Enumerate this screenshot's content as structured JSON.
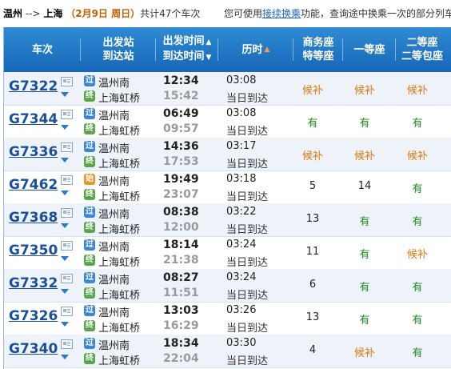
{
  "header": {
    "from": "温州",
    "arrow": "-->",
    "to": "上海",
    "date": "（2月9日 周日）",
    "total_prefix": "共计",
    "total_count": "47",
    "total_suffix": "个车次",
    "tip_prefix": "您可使用",
    "tip_link": "接续换乘",
    "tip_suffix": "功能，查询途中换乘一次的部分列车"
  },
  "columns": {
    "train": "车次",
    "station_dep": "出发站",
    "station_arr": "到达站",
    "time_dep": "出发时间",
    "time_arr": "到达时间",
    "duration": "历时",
    "business_1": "商务座",
    "business_2": "特等座",
    "first": "一等座",
    "second_1": "二等座",
    "second_2": "二等包座"
  },
  "trains": [
    {
      "no": "G7322",
      "dep_station": "温州南",
      "dep_type": "过",
      "arr_station": "上海虹桥",
      "arr_type": "终",
      "dep": "12:34",
      "arr": "15:42",
      "duration": "03:08",
      "arrive_day": "当日到达",
      "business": "候补",
      "first": "候补",
      "second": "候补"
    },
    {
      "no": "G7344",
      "dep_station": "温州南",
      "dep_type": "过",
      "arr_station": "上海虹桥",
      "arr_type": "终",
      "dep": "06:49",
      "arr": "09:57",
      "duration": "03:08",
      "arrive_day": "当日到达",
      "business": "有",
      "first": "有",
      "second": "有"
    },
    {
      "no": "G7336",
      "dep_station": "温州南",
      "dep_type": "过",
      "arr_station": "上海虹桥",
      "arr_type": "终",
      "dep": "14:36",
      "arr": "17:53",
      "duration": "03:17",
      "arrive_day": "当日到达",
      "business": "候补",
      "first": "候补",
      "second": "候补"
    },
    {
      "no": "G7462",
      "dep_station": "温州南",
      "dep_type": "始",
      "arr_station": "上海虹桥",
      "arr_type": "终",
      "dep": "19:49",
      "arr": "23:07",
      "duration": "03:18",
      "arrive_day": "当日到达",
      "business": "5",
      "first": "14",
      "second": "有"
    },
    {
      "no": "G7368",
      "dep_station": "温州南",
      "dep_type": "过",
      "arr_station": "上海虹桥",
      "arr_type": "终",
      "dep": "08:38",
      "arr": "12:00",
      "duration": "03:22",
      "arrive_day": "当日到达",
      "business": "13",
      "first": "有",
      "second": "有"
    },
    {
      "no": "G7350",
      "dep_station": "温州南",
      "dep_type": "过",
      "arr_station": "上海虹桥",
      "arr_type": "终",
      "dep": "18:14",
      "arr": "21:38",
      "duration": "03:24",
      "arrive_day": "当日到达",
      "business": "11",
      "first": "有",
      "second": "候补"
    },
    {
      "no": "G7332",
      "dep_station": "温州南",
      "dep_type": "过",
      "arr_station": "上海虹桥",
      "arr_type": "终",
      "dep": "08:27",
      "arr": "11:51",
      "duration": "03:24",
      "arrive_day": "当日到达",
      "business": "6",
      "first": "有",
      "second": "有"
    },
    {
      "no": "G7326",
      "dep_station": "温州南",
      "dep_type": "过",
      "arr_station": "上海虹桥",
      "arr_type": "终",
      "dep": "13:03",
      "arr": "16:29",
      "duration": "03:26",
      "arrive_day": "当日到达",
      "business": "13",
      "first": "有",
      "second": "有"
    },
    {
      "no": "G7340",
      "dep_station": "温州南",
      "dep_type": "过",
      "arr_station": "上海虹桥",
      "arr_type": "终",
      "dep": "18:34",
      "arr": "22:04",
      "duration": "03:30",
      "arrive_day": "当日到达",
      "business": "4",
      "first": "候补",
      "second": "有"
    }
  ],
  "colors": {
    "header_bg": "#1f74c4",
    "available_green": "#1f8a1f",
    "waitlist_orange": "#e07a10",
    "train_link": "#1b4f9c"
  }
}
